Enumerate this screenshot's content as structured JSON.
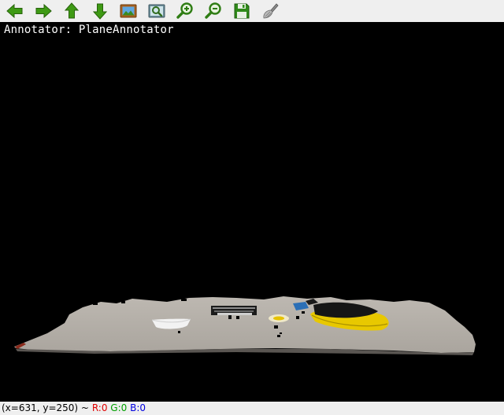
{
  "toolbar": {
    "buttons": [
      {
        "name": "pan-left",
        "icon": "arrow-left-icon",
        "color": "#3a8a12"
      },
      {
        "name": "pan-right",
        "icon": "arrow-right-icon",
        "color": "#3a8a12"
      },
      {
        "name": "pan-up",
        "icon": "arrow-up-icon",
        "color": "#3a8a12"
      },
      {
        "name": "pan-down",
        "icon": "arrow-down-icon",
        "color": "#3a8a12"
      },
      {
        "name": "zoom-to-window",
        "icon": "picture-icon"
      },
      {
        "name": "zoom-fit",
        "icon": "zoom-fit-icon"
      },
      {
        "name": "zoom-in",
        "icon": "zoom-in-icon"
      },
      {
        "name": "zoom-out",
        "icon": "zoom-out-icon"
      },
      {
        "name": "save-image",
        "icon": "floppy-disk-icon"
      },
      {
        "name": "properties",
        "icon": "brush-icon"
      }
    ]
  },
  "view": {
    "annotator_label": "Annotator: PlaneAnnotator"
  },
  "status": {
    "coords": "(x=631, y=250) ~",
    "r": "R:0",
    "g": "G:0",
    "b": "B:0",
    "r_color": "#e00000",
    "g_color": "#00a000",
    "b_color": "#0000e0"
  }
}
